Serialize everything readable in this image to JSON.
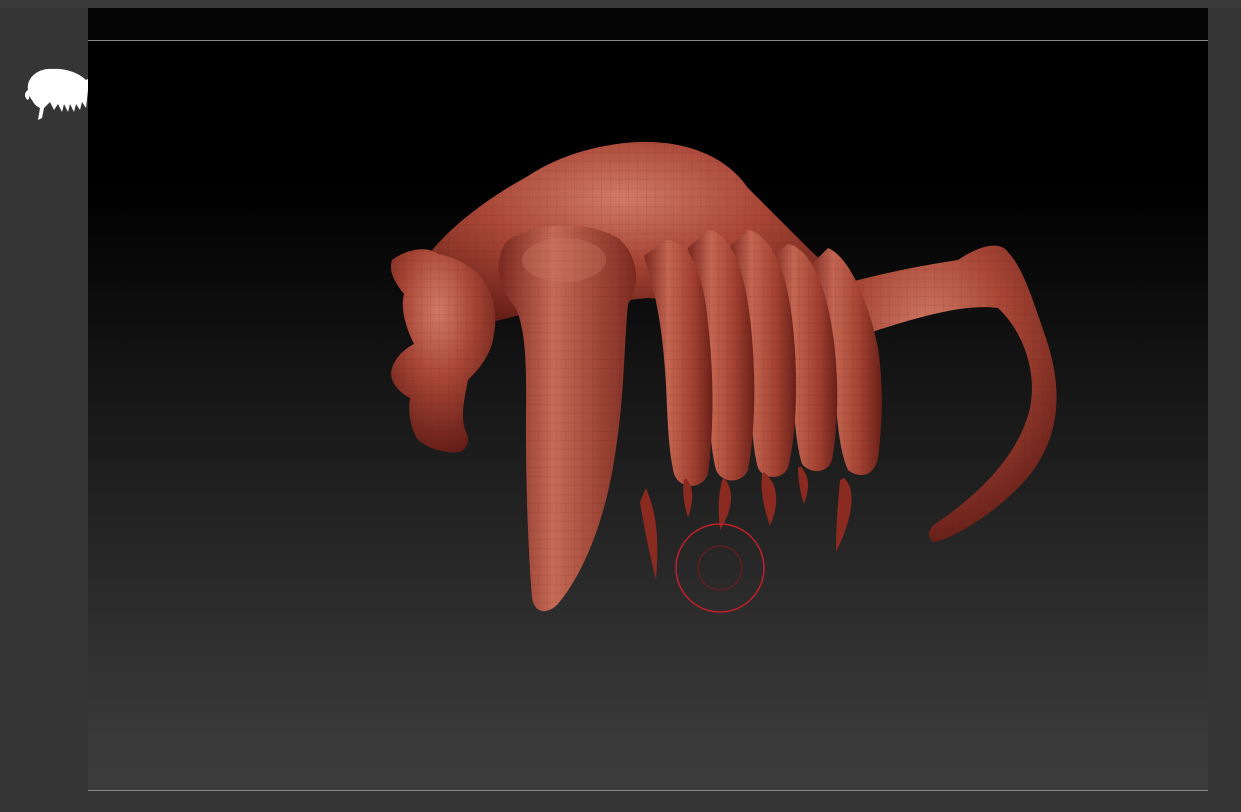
{
  "app": {
    "logo_icon": "mammoth-logo-icon",
    "viewport": {
      "model_name_icon": "sculpt-mesh",
      "colors": {
        "mesh": "#b04a3c",
        "background_top": "#000000",
        "background_bottom": "#3c3c3c",
        "cursor": "#c0202a"
      }
    }
  }
}
